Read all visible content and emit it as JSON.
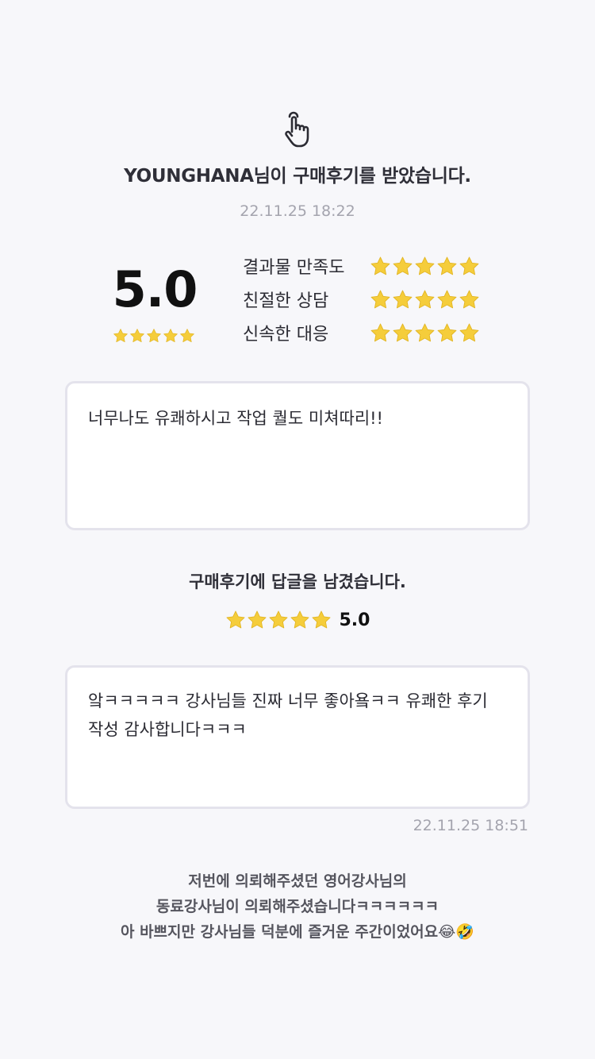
{
  "header": {
    "icon": "pointing-hand-icon",
    "title": "YOUNGHANA님이 구매후기를 받았습니다.",
    "timestamp": "22.11.25 18:22"
  },
  "rating": {
    "overall": "5.0",
    "overall_stars": 5,
    "categories": [
      {
        "label": "결과물 만족도",
        "stars": 5
      },
      {
        "label": "친절한 상담",
        "stars": 5
      },
      {
        "label": "신속한 대응",
        "stars": 5
      }
    ]
  },
  "review": {
    "text": "너무나도 유쾌하시고 작업 퀄도 미쳐따리!!"
  },
  "reply": {
    "title": "구매후기에 답글을 남겼습니다.",
    "stars": 5,
    "score": "5.0",
    "text": "앜ㅋㅋㅋㅋㅋ 강사님들 진짜 너무 좋아욬ㅋㅋ 유쾌한 후기 작성 감사합니다ㅋㅋㅋ",
    "timestamp": "22.11.25 18:51"
  },
  "caption": {
    "lines": [
      "저번에 의뢰해주셨던 영어강사님의",
      "동료강사님이 의뢰해주셨습니다ㅋㅋㅋㅋㅋㅋ",
      "아 바쁘지만 강사님들 덕분에 즐거운 주간이었어요😂🤣"
    ]
  },
  "colors": {
    "background": "#f7f7fa",
    "star": "#f5cd3b",
    "muted_text": "#a4a4ae",
    "card_border": "#e4e3ec"
  }
}
